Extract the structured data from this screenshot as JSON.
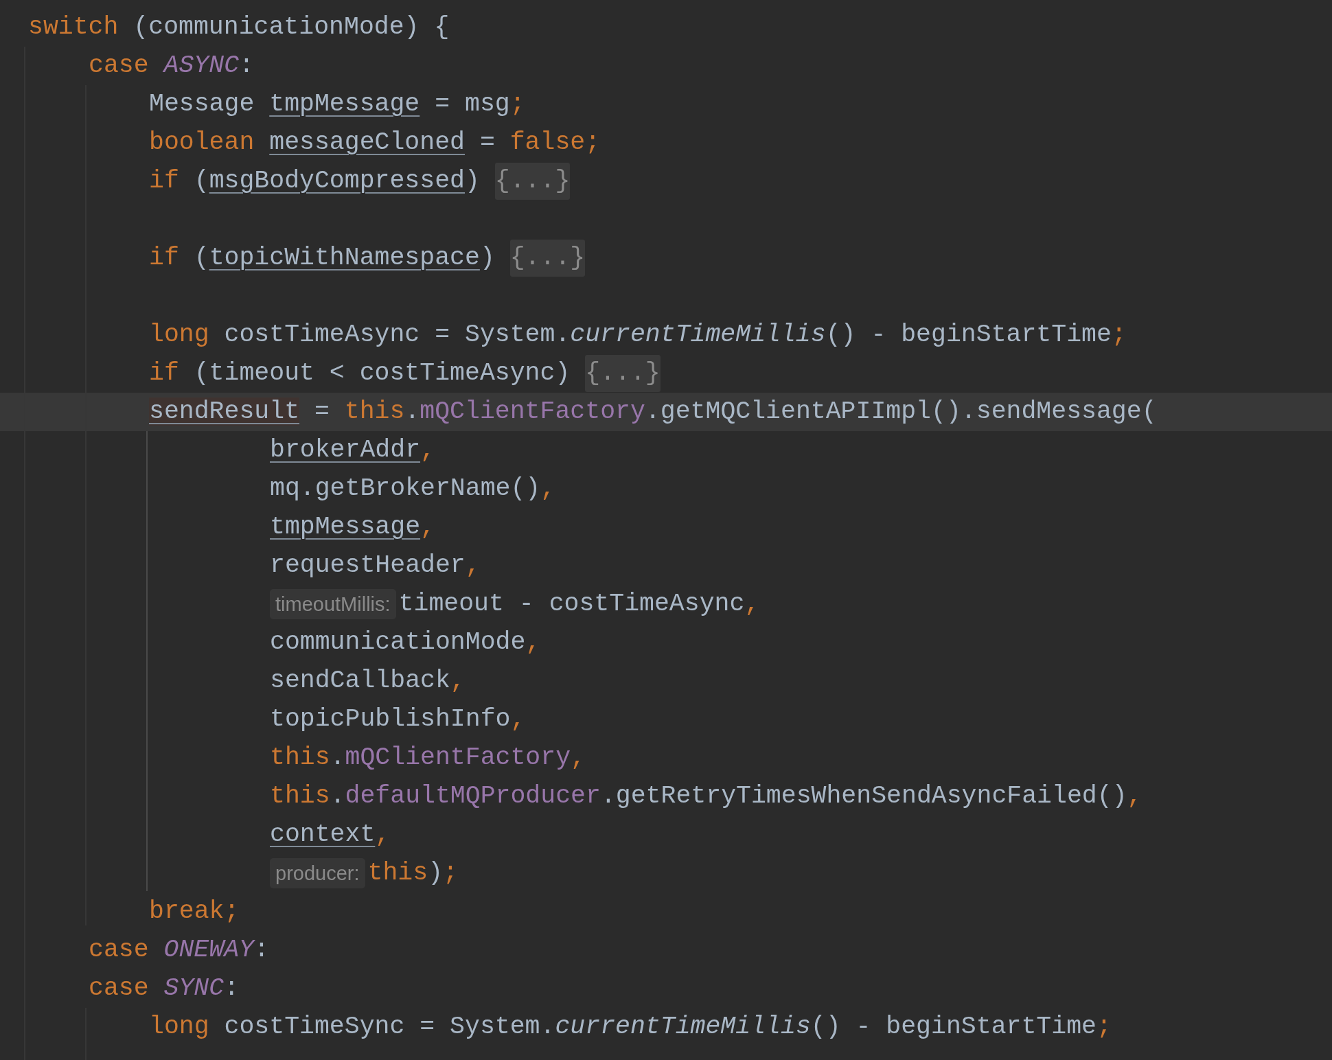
{
  "lines": [
    {
      "kind": "block",
      "current": false,
      "tokens": [
        {
          "text": "switch",
          "kind": "keyword"
        },
        {
          "text": " (communicationMode) {",
          "kind": "plain"
        }
      ]
    },
    {
      "kind": "case",
      "current": false,
      "tokens": [
        {
          "text": "case ",
          "kind": "keyword"
        },
        {
          "text": "ASYNC",
          "kind": "constant"
        },
        {
          "text": ":",
          "kind": "plain"
        }
      ]
    },
    {
      "kind": "statement",
      "current": false,
      "tokens": [
        {
          "text": "Message ",
          "kind": "plain"
        },
        {
          "text": "tmpMessage",
          "kind": "variable"
        },
        {
          "text": " = msg",
          "kind": "plain"
        },
        {
          "text": ";",
          "kind": "keyword"
        }
      ]
    },
    {
      "kind": "statement",
      "current": false,
      "tokens": [
        {
          "text": "boolean ",
          "kind": "keyword"
        },
        {
          "text": "messageCloned",
          "kind": "variable"
        },
        {
          "text": " = ",
          "kind": "plain"
        },
        {
          "text": "false;",
          "kind": "keyword"
        }
      ]
    },
    {
      "kind": "statement",
      "current": false,
      "tokens": [
        {
          "text": "if",
          "kind": "keyword"
        },
        {
          "text": " (",
          "kind": "plain"
        },
        {
          "text": "msgBodyCompressed",
          "kind": "variable"
        },
        {
          "text": ") ",
          "kind": "plain"
        },
        {
          "text": "{...}",
          "kind": "fold"
        }
      ]
    },
    {
      "kind": "statement",
      "current": false
    },
    {
      "kind": "statement",
      "current": false,
      "tokens": [
        {
          "text": "if",
          "kind": "keyword"
        },
        {
          "text": " (",
          "kind": "plain"
        },
        {
          "text": "topicWithNamespace",
          "kind": "variable"
        },
        {
          "text": ") ",
          "kind": "plain"
        },
        {
          "text": "{...}",
          "kind": "fold"
        }
      ]
    },
    {
      "kind": "statement",
      "current": false
    },
    {
      "kind": "statement",
      "current": false,
      "tokens": [
        {
          "text": "long",
          "kind": "keyword"
        },
        {
          "text": " costTimeAsync = System.",
          "kind": "plain"
        },
        {
          "text": "currentTimeMillis",
          "kind": "static"
        },
        {
          "text": "() - beginStartTime",
          "kind": "plain"
        },
        {
          "text": ";",
          "kind": "keyword"
        }
      ]
    },
    {
      "kind": "statement",
      "current": false,
      "tokens": [
        {
          "text": "if",
          "kind": "keyword"
        },
        {
          "text": " (timeout < costTimeAsync) ",
          "kind": "plain"
        },
        {
          "text": "{...}",
          "kind": "fold"
        }
      ]
    },
    {
      "kind": "statement",
      "current": true,
      "tokens": [
        {
          "text": "sendResult",
          "kind": "written"
        },
        {
          "text": " = ",
          "kind": "plain"
        },
        {
          "text": "this",
          "kind": "keyword"
        },
        {
          "text": ".",
          "kind": "plain"
        },
        {
          "text": "mQClientFactory",
          "kind": "field"
        },
        {
          "text": ".getMQClientAPIImpl().sendMessage(",
          "kind": "plain"
        }
      ]
    },
    {
      "kind": "argument",
      "current": false,
      "tokens": [
        {
          "text": "brokerAddr",
          "kind": "variable"
        },
        {
          "text": ",",
          "kind": "keyword"
        }
      ]
    },
    {
      "kind": "argument",
      "current": false,
      "tokens": [
        {
          "text": "mq.getBrokerName()",
          "kind": "plain"
        },
        {
          "text": ",",
          "kind": "keyword"
        }
      ]
    },
    {
      "kind": "argument",
      "current": false,
      "tokens": [
        {
          "text": "tmpMessage",
          "kind": "variable"
        },
        {
          "text": ",",
          "kind": "keyword"
        }
      ]
    },
    {
      "kind": "argument",
      "current": false,
      "tokens": [
        {
          "text": "requestHeader",
          "kind": "plain"
        },
        {
          "text": ",",
          "kind": "keyword"
        }
      ]
    },
    {
      "kind": "argument",
      "current": false,
      "tokens": [
        {
          "text": "timeoutMillis:",
          "kind": "hint"
        },
        {
          "text": "timeout - costTimeAsync",
          "kind": "plain"
        },
        {
          "text": ",",
          "kind": "keyword"
        }
      ]
    },
    {
      "kind": "argument",
      "current": false,
      "tokens": [
        {
          "text": "communicationMode",
          "kind": "plain"
        },
        {
          "text": ",",
          "kind": "keyword"
        }
      ]
    },
    {
      "kind": "argument",
      "current": false,
      "tokens": [
        {
          "text": "sendCallback",
          "kind": "plain"
        },
        {
          "text": ",",
          "kind": "keyword"
        }
      ]
    },
    {
      "kind": "argument",
      "current": false,
      "tokens": [
        {
          "text": "topicPublishInfo",
          "kind": "plain"
        },
        {
          "text": ",",
          "kind": "keyword"
        }
      ]
    },
    {
      "kind": "argument",
      "current": false,
      "tokens": [
        {
          "text": "this",
          "kind": "keyword"
        },
        {
          "text": ".",
          "kind": "plain"
        },
        {
          "text": "mQClientFactory",
          "kind": "field"
        },
        {
          "text": ",",
          "kind": "keyword"
        }
      ]
    },
    {
      "kind": "argument",
      "current": false,
      "tokens": [
        {
          "text": "this",
          "kind": "keyword"
        },
        {
          "text": ".",
          "kind": "plain"
        },
        {
          "text": "defaultMQProducer",
          "kind": "field"
        },
        {
          "text": ".getRetryTimesWhenSendAsyncFailed()",
          "kind": "plain"
        },
        {
          "text": ",",
          "kind": "keyword"
        }
      ]
    },
    {
      "kind": "argument",
      "current": false,
      "tokens": [
        {
          "text": "context",
          "kind": "variable"
        },
        {
          "text": ",",
          "kind": "keyword"
        }
      ]
    },
    {
      "kind": "argument",
      "current": false,
      "tokens": [
        {
          "text": "producer:",
          "kind": "hint"
        },
        {
          "text": "this",
          "kind": "keyword"
        },
        {
          "text": ")",
          "kind": "plain"
        },
        {
          "text": ";",
          "kind": "keyword"
        }
      ]
    },
    {
      "kind": "statement",
      "current": false,
      "tokens": [
        {
          "text": "break;",
          "kind": "keyword"
        }
      ]
    },
    {
      "kind": "case",
      "current": false,
      "tokens": [
        {
          "text": "case ",
          "kind": "keyword"
        },
        {
          "text": "ONEWAY",
          "kind": "constant"
        },
        {
          "text": ":",
          "kind": "plain"
        }
      ]
    },
    {
      "kind": "case",
      "current": false,
      "tokens": [
        {
          "text": "case ",
          "kind": "keyword"
        },
        {
          "text": "SYNC",
          "kind": "constant"
        },
        {
          "text": ":",
          "kind": "plain"
        }
      ]
    },
    {
      "kind": "statement",
      "current": false,
      "tokens": [
        {
          "text": "long",
          "kind": "keyword"
        },
        {
          "text": " costTimeSync = System.",
          "kind": "plain"
        },
        {
          "text": "currentTimeMillis",
          "kind": "static"
        },
        {
          "text": "() - beginStartTime",
          "kind": "plain"
        },
        {
          "text": ";",
          "kind": "keyword"
        }
      ]
    }
  ]
}
